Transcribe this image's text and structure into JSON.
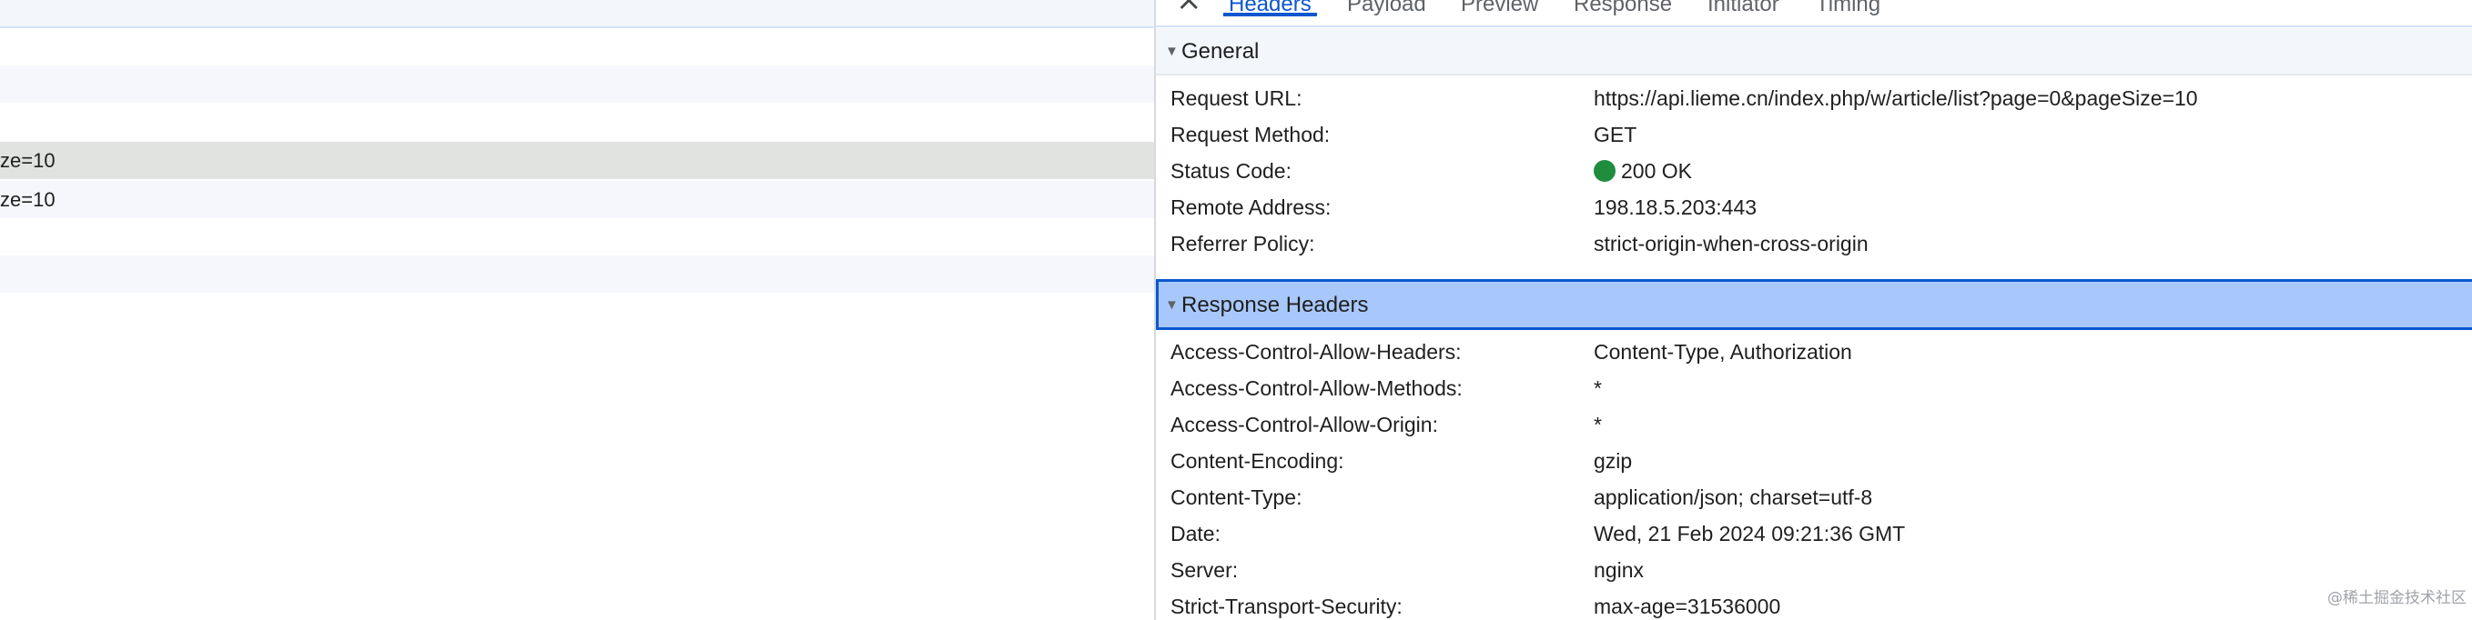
{
  "request_list": {
    "rows": [
      {
        "text": ""
      },
      {
        "text": ""
      },
      {
        "text": "ze=10"
      },
      {
        "text": "ze=10"
      },
      {
        "text": ""
      },
      {
        "text": ""
      }
    ]
  },
  "tabs": {
    "close_label": "×",
    "items": [
      {
        "label": "Headers"
      },
      {
        "label": "Payload"
      },
      {
        "label": "Preview"
      },
      {
        "label": "Response"
      },
      {
        "label": "Initiator"
      },
      {
        "label": "Timing"
      }
    ],
    "active": "Headers"
  },
  "general": {
    "title": "General",
    "expanded_icon": "▼",
    "rows": [
      {
        "key": "Request URL:",
        "value": "https://api.lieme.cn/index.php/w/article/list?page=0&pageSize=10"
      },
      {
        "key": "Request Method:",
        "value": "GET"
      },
      {
        "key": "Status Code:",
        "value": "200 OK"
      },
      {
        "key": "Remote Address:",
        "value": "198.18.5.203:443"
      },
      {
        "key": "Referrer Policy:",
        "value": "strict-origin-when-cross-origin"
      }
    ],
    "status_dot_color": "#1e8e3e"
  },
  "response_headers": {
    "title": "Response Headers",
    "expanded_icon": "▼",
    "rows": [
      {
        "key": "Access-Control-Allow-Headers:",
        "value": "Content-Type, Authorization"
      },
      {
        "key": "Access-Control-Allow-Methods:",
        "value": "*"
      },
      {
        "key": "Access-Control-Allow-Origin:",
        "value": "*"
      },
      {
        "key": "Content-Encoding:",
        "value": "gzip"
      },
      {
        "key": "Content-Type:",
        "value": "application/json; charset=utf-8"
      },
      {
        "key": "Date:",
        "value": "Wed, 21 Feb 2024 09:21:36 GMT"
      },
      {
        "key": "Server:",
        "value": "nginx"
      },
      {
        "key": "Strict-Transport-Security:",
        "value": "max-age=31536000"
      }
    ]
  },
  "watermark": "@稀土掘金技术社区",
  "colors": {
    "accent": "#0b57d0",
    "selected_section_bg": "#a8c7fa",
    "selected_row_bg": "#e1e3e1"
  }
}
